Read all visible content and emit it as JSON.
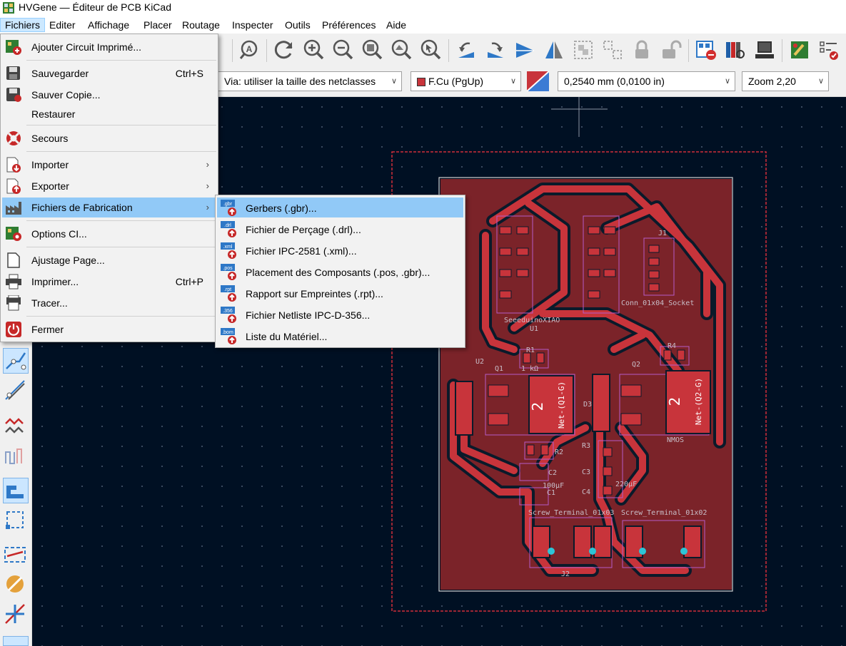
{
  "window": {
    "title": "HVGene — Éditeur de PCB KiCad"
  },
  "menubar": {
    "items": [
      {
        "label": "Fichiers",
        "active": true
      },
      {
        "label": "Editer"
      },
      {
        "label": "Affichage"
      },
      {
        "label": "Placer"
      },
      {
        "label": "Routage"
      },
      {
        "label": "Inspecter"
      },
      {
        "label": "Outils"
      },
      {
        "label": "Préférences"
      },
      {
        "label": "Aide"
      }
    ]
  },
  "aux_toolbar": {
    "via_select": "Via: utiliser la taille des netclasses",
    "layer_select": "F.Cu (PgUp)",
    "grid_select": "0,2540 mm (0,0100 in)",
    "zoom_select": "Zoom 2,20"
  },
  "file_menu": {
    "items": [
      {
        "label": "Ajouter Circuit Imprimé...",
        "icon": "add-board-icon"
      },
      {
        "label": "Sauvegarder",
        "shortcut": "Ctrl+S",
        "icon": "save-icon"
      },
      {
        "label": "Sauver Copie...",
        "icon": "save-copy-icon"
      },
      {
        "label": "Restaurer"
      },
      {
        "label": "Secours",
        "icon": "lifebuoy-icon"
      },
      {
        "label": "Importer",
        "icon": "import-icon",
        "submenu": true
      },
      {
        "label": "Exporter",
        "icon": "export-icon",
        "submenu": true
      },
      {
        "label": "Fichiers de Fabrication",
        "icon": "factory-icon",
        "submenu": true,
        "highlighted": true
      },
      {
        "label": "Options CI...",
        "icon": "board-setup-icon"
      },
      {
        "label": "Ajustage Page...",
        "icon": "page-settings-icon"
      },
      {
        "label": "Imprimer...",
        "shortcut": "Ctrl+P",
        "icon": "print-icon"
      },
      {
        "label": "Tracer...",
        "icon": "plot-icon"
      },
      {
        "label": "Fermer",
        "icon": "power-icon"
      }
    ]
  },
  "fab_submenu": {
    "items": [
      {
        "label": "Gerbers (.gbr)...",
        "badge": ".gbr",
        "highlighted": true
      },
      {
        "label": "Fichier de Perçage (.drl)...",
        "badge": ".drl"
      },
      {
        "label": "Fichier IPC-2581 (.xml)...",
        "badge": ".xml"
      },
      {
        "label": "Placement des Composants (.pos, .gbr)...",
        "badge": ".pos"
      },
      {
        "label": "Rapport sur Empreintes (.rpt)...",
        "badge": ".rpt"
      },
      {
        "label": "Fichier Netliste IPC-D-356...",
        "badge": ".356"
      },
      {
        "label": "Liste du Matériel...",
        "badge": ".bom"
      }
    ]
  },
  "pcb": {
    "reference_labels": [
      "SeeeduinoXIAO",
      "U1",
      "Conn_01x04_Socket",
      "J1",
      "U2",
      "R1",
      "1 kΩ",
      "Q1",
      "R4",
      "Q2",
      "D3",
      "R3",
      "R2",
      "C2",
      "C3",
      "C4",
      "C1",
      "NMOS",
      "Screw_Terminal_01x03",
      "Screw_Terminal_01x02",
      "J2",
      "100µF",
      "220µF"
    ],
    "pad_labels": [
      "2",
      "2"
    ],
    "net_labels": [
      "Net-(Q1-G)",
      "Net-(Q2-G)"
    ],
    "colors": {
      "board": "#7b2329",
      "copper": "#c8343b",
      "edge": "#d0d0d0",
      "background": "#001023"
    }
  }
}
